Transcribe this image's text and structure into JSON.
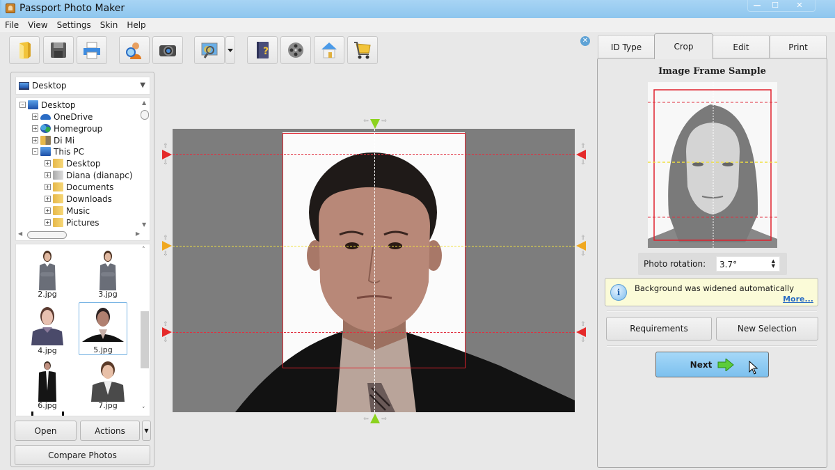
{
  "window": {
    "title": "Passport Photo Maker",
    "controls": [
      "minimize",
      "maximize",
      "close"
    ]
  },
  "menu": [
    "File",
    "View",
    "Settings",
    "Skin",
    "Help"
  ],
  "toolbar": {
    "buttons": [
      {
        "name": "open-folder",
        "icon": "folder-icon"
      },
      {
        "name": "save",
        "icon": "floppy-disk-icon"
      },
      {
        "name": "print",
        "icon": "printer-icon"
      },
      {
        "name": "user-search",
        "icon": "user-search-icon"
      },
      {
        "name": "camera",
        "icon": "camera-icon"
      },
      {
        "name": "image-zoom",
        "icon": "image-magnifier-icon",
        "has_dropdown": true
      },
      {
        "name": "help",
        "icon": "help-book-icon"
      },
      {
        "name": "video-tutorial",
        "icon": "film-reel-icon"
      },
      {
        "name": "home",
        "icon": "home-icon"
      },
      {
        "name": "buy",
        "icon": "shopping-cart-icon"
      }
    ]
  },
  "browser": {
    "location": "Desktop",
    "tree": [
      {
        "label": "Desktop",
        "level": 0,
        "expanded": true,
        "icon": "monitor-icon"
      },
      {
        "label": "OneDrive",
        "level": 1,
        "expanded": false,
        "icon": "cloud-icon"
      },
      {
        "label": "Homegroup",
        "level": 1,
        "expanded": false,
        "icon": "homegroup-icon"
      },
      {
        "label": "Di Mi",
        "level": 1,
        "expanded": false,
        "icon": "user-folder-icon"
      },
      {
        "label": "This PC",
        "level": 1,
        "expanded": true,
        "icon": "computer-icon"
      },
      {
        "label": "Desktop",
        "level": 2,
        "expanded": false,
        "icon": "folder-icon"
      },
      {
        "label": "Diana (dianapc)",
        "level": 2,
        "expanded": false,
        "icon": "network-drive-icon"
      },
      {
        "label": "Documents",
        "level": 2,
        "expanded": false,
        "icon": "folder-icon"
      },
      {
        "label": "Downloads",
        "level": 2,
        "expanded": false,
        "icon": "folder-icon"
      },
      {
        "label": "Music",
        "level": 2,
        "expanded": false,
        "icon": "folder-icon"
      },
      {
        "label": "Pictures",
        "level": 2,
        "expanded": false,
        "icon": "folder-icon"
      }
    ],
    "thumbnails": [
      {
        "file": "2.jpg",
        "selected": false
      },
      {
        "file": "3.jpg",
        "selected": false
      },
      {
        "file": "4.jpg",
        "selected": false
      },
      {
        "file": "5.jpg",
        "selected": true
      },
      {
        "file": "6.jpg",
        "selected": false
      },
      {
        "file": "7.jpg",
        "selected": false
      }
    ],
    "open_label": "Open",
    "actions_label": "Actions",
    "compare_label": "Compare Photos"
  },
  "tabs": [
    {
      "label": "ID Type",
      "active": false
    },
    {
      "label": "Crop",
      "active": true
    },
    {
      "label": "Edit",
      "active": false
    },
    {
      "label": "Print",
      "active": false
    }
  ],
  "crop": {
    "sample_title": "Image Frame Sample",
    "rotation_label": "Photo rotation:",
    "rotation_value": "3.7°",
    "info_message": "Background was widened automatically",
    "more_link": "More...",
    "requirements_label": "Requirements",
    "new_selection_label": "New Selection",
    "next_label": "Next"
  },
  "colors": {
    "crop_frame": "#e0202c",
    "guide_top_chin": "#e03040",
    "guide_eyes": "#f0e040",
    "center_marker": "#8cd21e",
    "next_button": "#8ccaf2"
  }
}
